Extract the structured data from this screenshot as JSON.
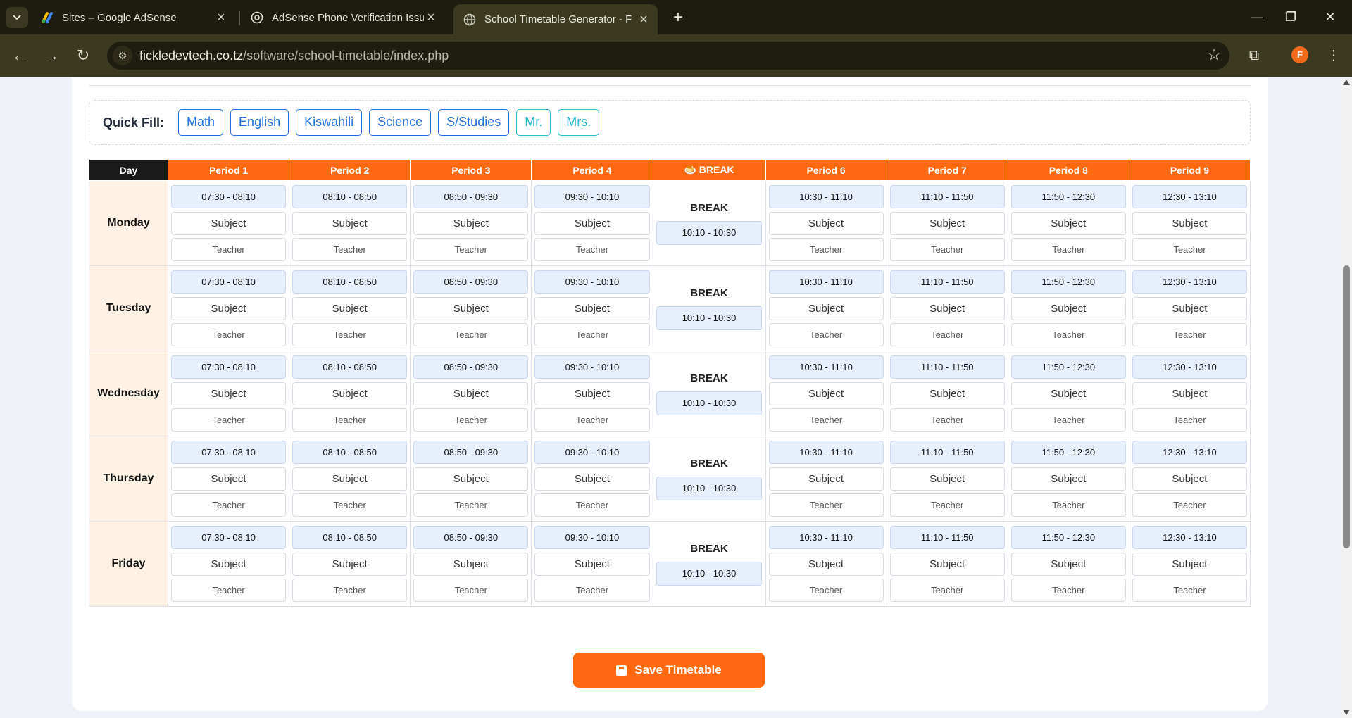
{
  "browser": {
    "tabs": [
      {
        "title": "Sites – Google AdSense",
        "active": false
      },
      {
        "title": "AdSense Phone Verification Issu",
        "active": false
      },
      {
        "title": "School Timetable Generator - F",
        "active": true
      }
    ],
    "url_host": "fickledevtech.co.tz",
    "url_path": "/software/school-timetable/index.php",
    "profile_initial": "F"
  },
  "quick_fill": {
    "label": "Quick Fill:",
    "subjects": [
      "Math",
      "English",
      "Kiswahili",
      "Science",
      "S/Studies"
    ],
    "titles": [
      "Mr.",
      "Mrs."
    ]
  },
  "timetable": {
    "day_header": "Day",
    "break_header": "🍮 BREAK",
    "periods": [
      "Period 1",
      "Period 2",
      "Period 3",
      "Period 4",
      "Period 6",
      "Period 7",
      "Period 8",
      "Period 9"
    ],
    "times_before_break": [
      "07:30 - 08:10",
      "08:10 - 08:50",
      "08:50 - 09:30",
      "09:30 - 10:10"
    ],
    "times_after_break": [
      "10:30 - 11:10",
      "11:10 - 11:50",
      "11:50 - 12:30",
      "12:30 - 13:10"
    ],
    "break_label": "BREAK",
    "break_time": "10:10 - 10:30",
    "subject_placeholder": "Subject",
    "teacher_placeholder": "Teacher",
    "days": [
      "Monday",
      "Tuesday",
      "Wednesday",
      "Thursday",
      "Friday"
    ]
  },
  "save_button": "Save Timetable",
  "colors": {
    "accent": "#ff6a10",
    "link": "#1f6fe0",
    "teal": "#22b8cf"
  }
}
